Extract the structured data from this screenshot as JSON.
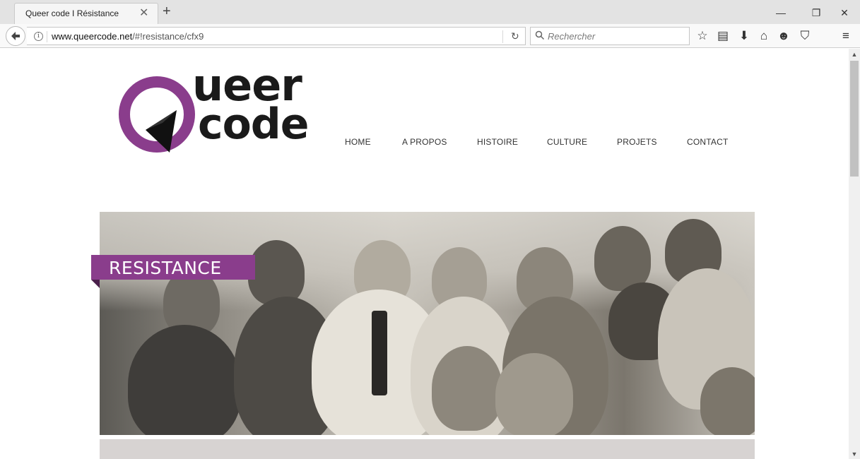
{
  "browser": {
    "tab": {
      "title": "Queer code I Résistance"
    },
    "url": {
      "domain": "www.queercode.net",
      "path": "/#!resistance/cfx9"
    },
    "search": {
      "placeholder": "Rechercher"
    }
  },
  "site": {
    "logo": {
      "line1": "ueer",
      "line2": "code"
    },
    "menu": [
      "HOME",
      "A PROPOS",
      "HISTOIRE",
      "CULTURE",
      "PROJETS",
      "CONTACT"
    ],
    "hero": {
      "title": "RESISTANCE"
    }
  },
  "colors": {
    "brand_purple": "#8a3d8c",
    "logo_black": "#1a1a1a",
    "footer_gray": "#d7d3d2"
  },
  "icons": {
    "toolbar": [
      "star-icon",
      "reading-list-icon",
      "download-icon",
      "home-icon",
      "chat-icon",
      "pocket-icon",
      "menu-icon"
    ]
  }
}
